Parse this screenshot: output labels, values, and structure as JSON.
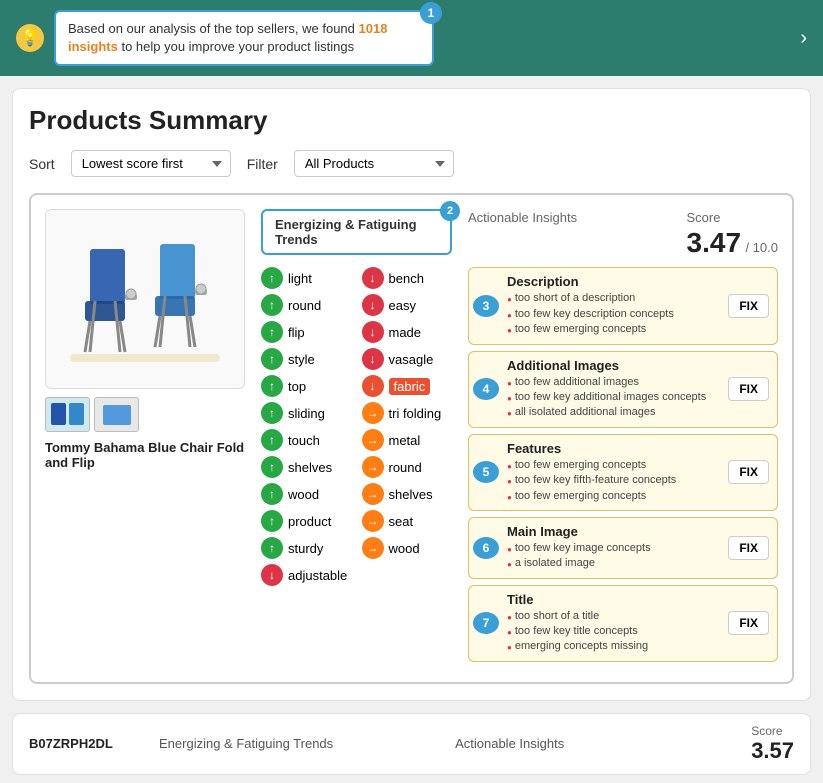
{
  "banner": {
    "text_prefix": "Based on our analysis of the top sellers, we found ",
    "highlight": "1018 insights",
    "text_suffix": " to help you improve your product listings",
    "badge": "1",
    "chevron": "›"
  },
  "page": {
    "title": "Products Summary"
  },
  "controls": {
    "sort_label": "Sort",
    "sort_value": "Lowest score first",
    "filter_label": "Filter",
    "filter_value": "All Products"
  },
  "product": {
    "name": "Tommy Bahama Blue Chair Fold and Flip"
  },
  "trends": {
    "header": "Energizing & Fatiguing Trends",
    "badge": "2",
    "items": [
      {
        "label": "light",
        "type": "green"
      },
      {
        "label": "bench",
        "type": "red"
      },
      {
        "label": "round",
        "type": "green"
      },
      {
        "label": "easy",
        "type": "red"
      },
      {
        "label": "flip",
        "type": "green"
      },
      {
        "label": "made",
        "type": "red"
      },
      {
        "label": "style",
        "type": "green"
      },
      {
        "label": "vasagle",
        "type": "red"
      },
      {
        "label": "top",
        "type": "green"
      },
      {
        "label": "fabric",
        "type": "red-orange"
      },
      {
        "label": "sliding",
        "type": "green"
      },
      {
        "label": "tri folding",
        "type": "orange"
      },
      {
        "label": "touch",
        "type": "green"
      },
      {
        "label": "metal",
        "type": "orange"
      },
      {
        "label": "shelves",
        "type": "green"
      },
      {
        "label": "round",
        "type": "orange"
      },
      {
        "label": "wood",
        "type": "green"
      },
      {
        "label": "shelves",
        "type": "orange"
      },
      {
        "label": "product",
        "type": "green"
      },
      {
        "label": "seat",
        "type": "orange"
      },
      {
        "label": "sturdy",
        "type": "green"
      },
      {
        "label": "wood",
        "type": "orange"
      },
      {
        "label": "adjustable",
        "type": "red"
      }
    ]
  },
  "insights": {
    "label": "Actionable Insights",
    "score_value": "3.47",
    "score_total": "/ 10.0",
    "rows": [
      {
        "badge": "3",
        "section": "Description",
        "bullets": [
          "too short of a description",
          "too few key description concepts",
          "too few emerging concepts"
        ],
        "fix": "FIX"
      },
      {
        "badge": "4",
        "section": "Additional Images",
        "bullets": [
          "too few additional images",
          "too few key additional images concepts",
          "all isolated additional images"
        ],
        "fix": "FIX"
      },
      {
        "badge": "5",
        "section": "Features",
        "bullets": [
          "too few emerging concepts",
          "too few key fifth-feature concepts",
          "too few emerging concepts"
        ],
        "fix": "FIX"
      },
      {
        "badge": "6",
        "section": "Main Image",
        "bullets": [
          "too few key image concepts",
          "a isolated image"
        ],
        "fix": "FIX"
      },
      {
        "badge": "7",
        "section": "Title",
        "bullets": [
          "too short of a title",
          "too few key title concepts",
          "emerging concepts missing"
        ],
        "fix": "FIX"
      }
    ]
  },
  "bottom_preview": {
    "id": "B07ZRPH2DL",
    "trends_label": "Energizing & Fatiguing Trends",
    "insights_label": "Actionable Insights",
    "score_value": "3.57",
    "score_label": "Score"
  }
}
